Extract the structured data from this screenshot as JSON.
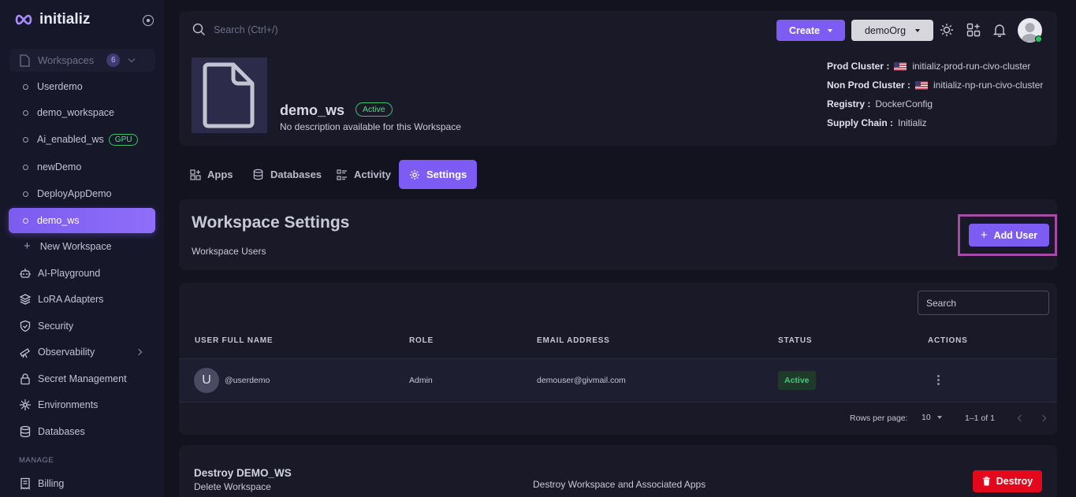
{
  "app": {
    "logo_text": "initializ"
  },
  "sidebar": {
    "workspaces_label": "Workspaces",
    "workspaces_count": "6",
    "workspace_items": [
      {
        "label": "Userdemo"
      },
      {
        "label": "demo_workspace"
      },
      {
        "label": "Ai_enabled_ws",
        "badge": "GPU"
      },
      {
        "label": "newDemo"
      },
      {
        "label": "DeployAppDemo"
      },
      {
        "label": "demo_ws",
        "active": true
      }
    ],
    "new_workspace": "New Workspace",
    "nav": [
      {
        "label": "AI-Playground",
        "icon": "robot-icon"
      },
      {
        "label": "LoRA Adapters",
        "icon": "layers-icon"
      },
      {
        "label": "Security",
        "icon": "shield-icon"
      },
      {
        "label": "Observability",
        "icon": "telescope-icon"
      },
      {
        "label": "Secret Management",
        "icon": "lock-icon"
      },
      {
        "label": "Environments",
        "icon": "cluster-icon"
      },
      {
        "label": "Databases",
        "icon": "database-icon"
      }
    ],
    "manage_label": "MANAGE",
    "billing": "Billing"
  },
  "header": {
    "search_placeholder": "Search (Ctrl+/)",
    "create_label": "Create",
    "org_label": "demoOrg"
  },
  "workspace": {
    "name": "demo_ws",
    "status": "Active",
    "description": "No description available for this Workspace",
    "meta": [
      {
        "label": "Prod Cluster :",
        "value": "initializ-prod-run-civo-cluster",
        "flag": true
      },
      {
        "label": "Non Prod Cluster :",
        "value": "initializ-np-run-civo-cluster",
        "flag": true
      },
      {
        "label": "Registry :",
        "value": "DockerConfig",
        "flag": false
      },
      {
        "label": "Supply Chain :",
        "value": "Initializ",
        "flag": false
      }
    ]
  },
  "tabs": [
    {
      "label": "Apps",
      "icon": "apps-icon"
    },
    {
      "label": "Databases",
      "icon": "database-icon"
    },
    {
      "label": "Activity",
      "icon": "activity-icon"
    },
    {
      "label": "Settings",
      "icon": "gear-icon",
      "active": true
    }
  ],
  "settings": {
    "title": "Workspace Settings",
    "subtitle": "Workspace Users",
    "add_user_label": "Add User"
  },
  "users_table": {
    "search_placeholder": "Search",
    "columns": [
      "USER FULL NAME",
      "ROLE",
      "EMAIL ADDRESS",
      "STATUS",
      "ACTIONS"
    ],
    "rows": [
      {
        "initial": "U",
        "name": "@userdemo",
        "role": "Admin",
        "email": "demouser@givmail.com",
        "status": "Active"
      }
    ],
    "rows_per_page_label": "Rows per page:",
    "rows_per_page": "10",
    "range": "1–1 of 1"
  },
  "destroy": {
    "title": "Destroy DEMO_WS",
    "subtitle": "Delete Workspace",
    "description": "Destroy Workspace and Associated Apps",
    "button_label": "Destroy"
  },
  "colors": {
    "accent": "#7c5cf2",
    "danger": "#e3081b",
    "success": "#3ad070"
  }
}
